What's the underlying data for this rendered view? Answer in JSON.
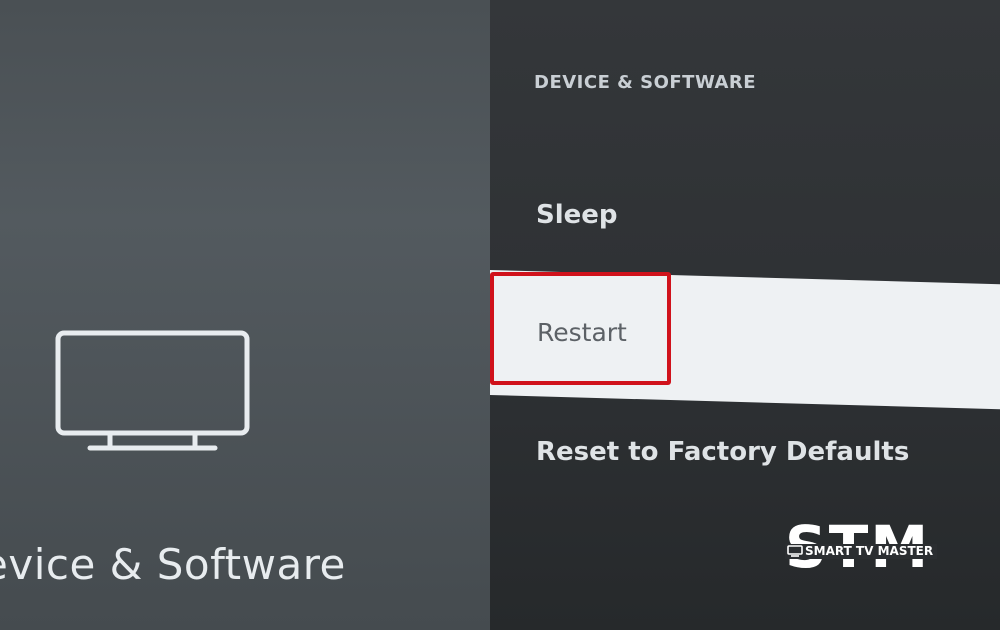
{
  "left_panel": {
    "title": "evice & Software",
    "icon": "tv-icon"
  },
  "right_panel": {
    "section_header": "DEVICE & SOFTWARE",
    "items": [
      {
        "label": "Sleep",
        "selected": false
      },
      {
        "label": "Restart",
        "selected": true
      },
      {
        "label": "Reset to Factory Defaults",
        "selected": false
      }
    ]
  },
  "annotation": {
    "highlight_color": "#d0121b",
    "target": "Restart"
  },
  "watermark": {
    "logo_text": "STM",
    "brand": "SMART TV MASTER"
  },
  "colors": {
    "selected_row": "#eef1f3",
    "text_light": "#dfe3e6"
  }
}
